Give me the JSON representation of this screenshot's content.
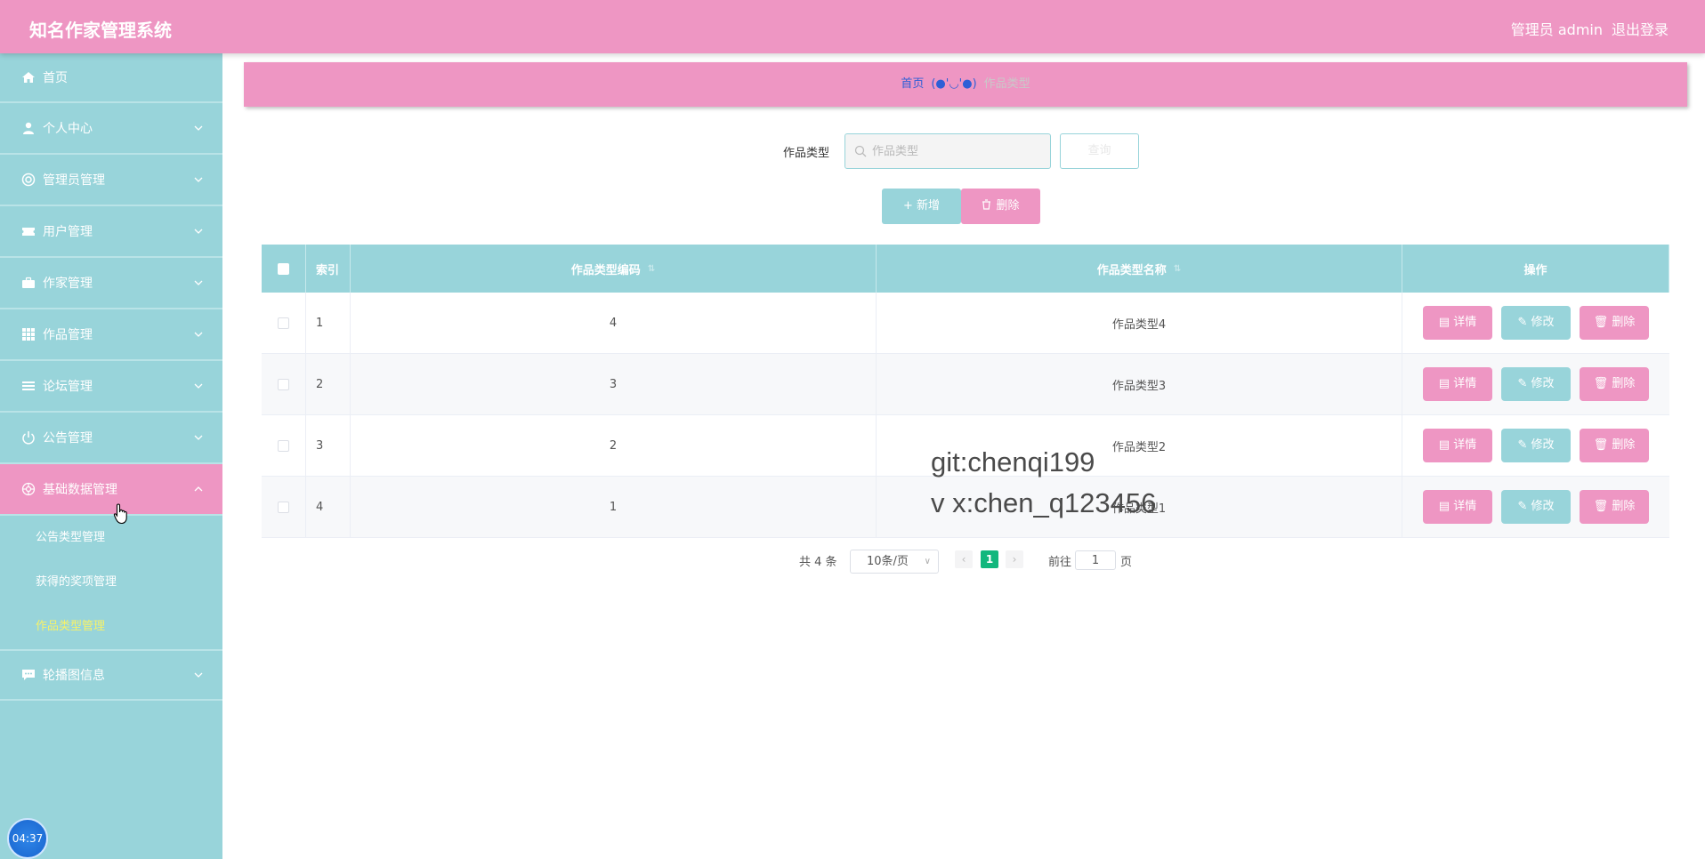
{
  "app": {
    "title": "知名作家管理系统",
    "user_label": "管理员 admin",
    "logout_label": "退出登录"
  },
  "sidebar": {
    "items": [
      {
        "label": "首页",
        "icon": "home-icon"
      },
      {
        "label": "个人中心",
        "icon": "person-icon"
      },
      {
        "label": "管理员管理",
        "icon": "settings-icon"
      },
      {
        "label": "用户管理",
        "icon": "ticket-icon"
      },
      {
        "label": "作家管理",
        "icon": "briefcase-icon"
      },
      {
        "label": "作品管理",
        "icon": "grid-icon"
      },
      {
        "label": "论坛管理",
        "icon": "list-icon"
      },
      {
        "label": "公告管理",
        "icon": "power-icon"
      },
      {
        "label": "基础数据管理",
        "icon": "gear-icon",
        "expanded": true
      },
      {
        "label": "轮播图信息",
        "icon": "chat-icon"
      }
    ],
    "submenu": [
      {
        "label": "公告类型管理"
      },
      {
        "label": "获得的奖项管理"
      },
      {
        "label": "作品类型管理",
        "current": true
      }
    ],
    "clock": "04:37"
  },
  "breadcrumb": {
    "home": "首页",
    "face": "(●'◡'●)",
    "current": "作品类型"
  },
  "search": {
    "label": "作品类型",
    "placeholder": "作品类型",
    "value": "",
    "button": "查询"
  },
  "actions": {
    "add": "+ 新增",
    "delete": "删除"
  },
  "table": {
    "headers": {
      "index": "索引",
      "code": "作品类型编码",
      "name": "作品类型名称",
      "ops": "操作"
    },
    "rows": [
      {
        "index": "1",
        "code": "4",
        "name": "作品类型4"
      },
      {
        "index": "2",
        "code": "3",
        "name": "作品类型3"
      },
      {
        "index": "3",
        "code": "2",
        "name": "作品类型2"
      },
      {
        "index": "4",
        "code": "1",
        "name": "作品类型1"
      }
    ],
    "row_actions": {
      "detail": "详情",
      "edit": "修改",
      "delete": "删除"
    }
  },
  "pagination": {
    "total": "共 4 条",
    "page_size": "10条/页",
    "current_page": "1",
    "goto_label": "前往",
    "goto_value": "1",
    "page_suffix": "页"
  },
  "watermark": {
    "line1": "git:chenqi199",
    "line2": "v x:chen_q123456"
  },
  "colors": {
    "pink": "#ee96c3",
    "teal": "#98d4da",
    "active_page": "#12b77d",
    "current_sub": "#f6f26a"
  }
}
